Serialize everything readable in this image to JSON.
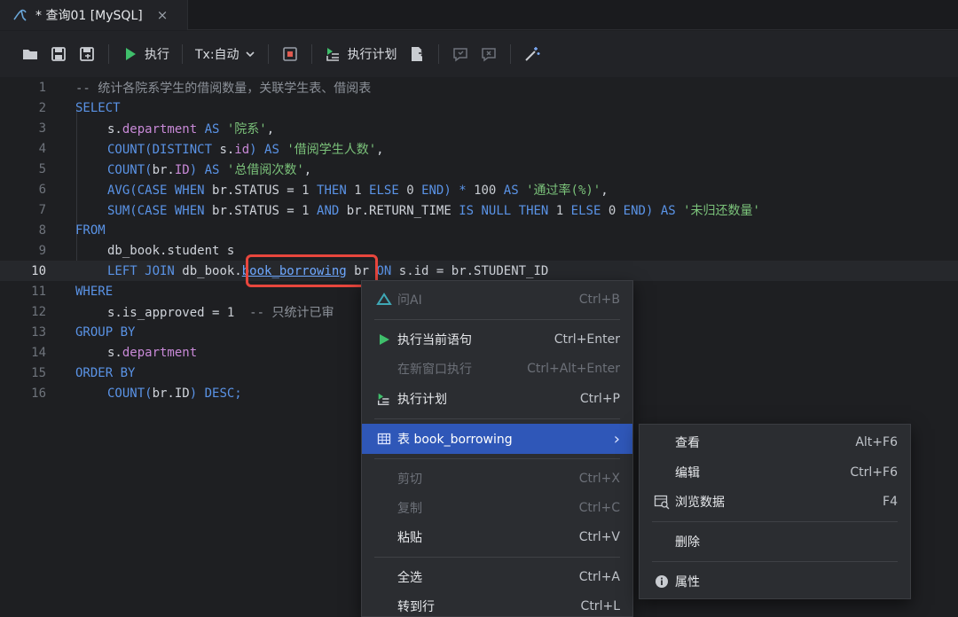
{
  "tab": {
    "title": "* 查询01 [MySQL]",
    "close": "×"
  },
  "toolbar": {
    "run_label": "执行",
    "tx_label": "Tx:自动",
    "plan_label": "执行计划"
  },
  "editor": {
    "current_line": 10,
    "lines": [
      "1",
      "2",
      "3",
      "4",
      "5",
      "6",
      "7",
      "8",
      "9",
      "10",
      "11",
      "12",
      "13",
      "14",
      "15",
      "16"
    ],
    "code": {
      "l1": "-- 统计各院系学生的借阅数量，关联学生表、借阅表",
      "l2": "SELECT",
      "l3_a": "s.",
      "l3_b": "department",
      "l3_c": " AS ",
      "l3_d": "'院系'",
      "l3_e": ",",
      "l4_a": "COUNT(DISTINCT ",
      "l4_b": "s.",
      "l4_c": "id",
      "l4_d": ") AS ",
      "l4_e": "'借阅学生人数'",
      "l4_f": ",",
      "l5_a": "COUNT(",
      "l5_b": "br.",
      "l5_c": "ID",
      "l5_d": ") AS ",
      "l5_e": "'总借阅次数'",
      "l5_f": ",",
      "l6_a": "AVG(CASE WHEN ",
      "l6_b": "br.STATUS = ",
      "l6_c": "1",
      "l6_d": " THEN ",
      "l6_e": "1",
      "l6_f": " ELSE ",
      "l6_g": "0",
      "l6_h": " END) * ",
      "l6_i": "100",
      "l6_j": " AS ",
      "l6_k": "'通过率(%)'",
      "l6_l": ",",
      "l7_a": "SUM(CASE WHEN ",
      "l7_b": "br.STATUS = ",
      "l7_c": "1",
      "l7_d": " AND ",
      "l7_e": "br.RETURN_TIME",
      "l7_f": " IS NULL THEN ",
      "l7_g": "1",
      "l7_h": " ELSE ",
      "l7_i": "0",
      "l7_j": " END) AS ",
      "l7_k": "'未归还数量'",
      "l8": "FROM",
      "l9": "db_book.student s",
      "l10_a": "LEFT JOIN ",
      "l10_b": "db_book.",
      "l10_c": "book_borrowing",
      "l10_d": " br ",
      "l10_e": "ON ",
      "l10_f": "s.id = br.STUDENT_ID",
      "l11": "WHERE",
      "l12_a": "s.is_approved = ",
      "l12_b": "1",
      "l12_c": "  -- 只统计已审",
      "l13": "GROUP BY",
      "l14_a": "s.",
      "l14_b": "department",
      "l15": "ORDER BY",
      "l16_a": "COUNT(",
      "l16_b": "br.ID",
      "l16_c": ") DESC;"
    }
  },
  "context_menu": {
    "items": [
      {
        "label": "问AI",
        "shortcut": "Ctrl+B"
      },
      {
        "label": "执行当前语句",
        "shortcut": "Ctrl+Enter"
      },
      {
        "label": "在新窗口执行",
        "shortcut": "Ctrl+Alt+Enter"
      },
      {
        "label": "执行计划",
        "shortcut": "Ctrl+P"
      },
      {
        "label": "表 book_borrowing",
        "shortcut": "›"
      },
      {
        "label": "剪切",
        "shortcut": "Ctrl+X"
      },
      {
        "label": "复制",
        "shortcut": "Ctrl+C"
      },
      {
        "label": "粘贴",
        "shortcut": "Ctrl+V"
      },
      {
        "label": "全选",
        "shortcut": "Ctrl+A"
      },
      {
        "label": "转到行",
        "shortcut": "Ctrl+L"
      }
    ]
  },
  "submenu": {
    "items": [
      {
        "label": "查看",
        "shortcut": "Alt+F6"
      },
      {
        "label": "编辑",
        "shortcut": "Ctrl+F6"
      },
      {
        "label": "浏览数据",
        "shortcut": "F4"
      },
      {
        "label": "删除",
        "shortcut": ""
      },
      {
        "label": "属性",
        "shortcut": ""
      }
    ]
  },
  "colors": {
    "accent": "#2f57b8",
    "highlight": "#e8463d",
    "keyword": "#5a93e6",
    "string": "#7bc27a"
  }
}
